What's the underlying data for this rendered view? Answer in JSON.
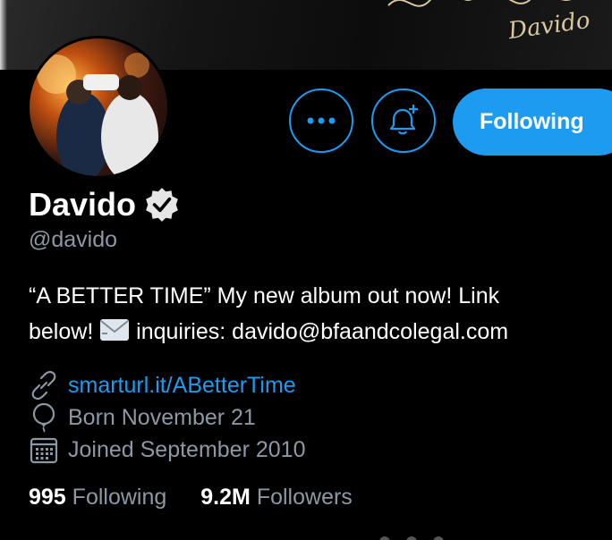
{
  "banner": {
    "signature": "Davido"
  },
  "actions": {
    "following_label": "Following"
  },
  "profile": {
    "name": "Davido",
    "handle": "@davido",
    "bio_line1": "“A BETTER TIME” My new album out now! Link",
    "bio_line2_a": "below! ",
    "bio_line2_b": " inquiries: davido@bfaandcolegal.com",
    "link": "smarturl.it/ABetterTime",
    "born": "Born November 21",
    "joined": "Joined September 2010"
  },
  "stats": {
    "following_count": "995",
    "following_label": "Following",
    "followers_count": "9.2M",
    "followers_label": "Followers"
  },
  "icons": {
    "more": "more-icon",
    "bell": "bell-add-icon",
    "verified": "verified-badge-icon",
    "link": "link-icon",
    "balloon": "balloon-icon",
    "calendar": "calendar-icon",
    "email": "envelope-emoji"
  },
  "colors": {
    "accent": "#1d9bf0",
    "muted": "#8b98a5",
    "background": "#000000"
  }
}
